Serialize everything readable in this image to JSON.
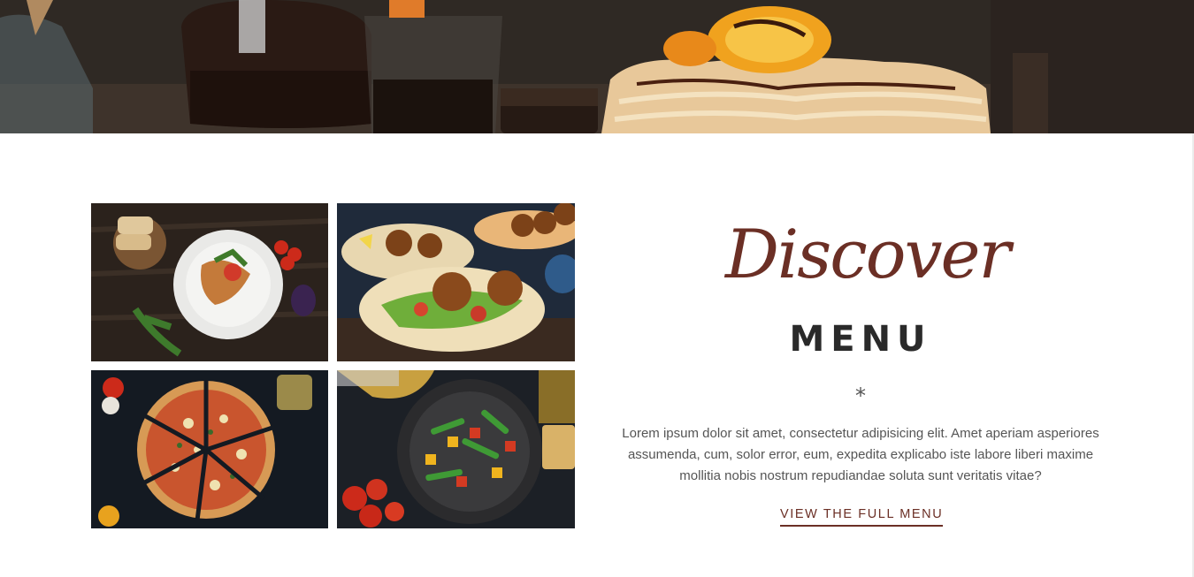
{
  "hero": {
    "image": "breakfast-table-pancakes-photo"
  },
  "gallery": {
    "images": [
      {
        "name": "grilled-chicken-plate-photo"
      },
      {
        "name": "falafel-wraps-photo"
      },
      {
        "name": "sliced-pizza-photo"
      },
      {
        "name": "vegetable-stir-fry-pan-photo"
      }
    ]
  },
  "intro": {
    "script_title": "Discover",
    "title": "MENU",
    "divider": "*",
    "body": "Lorem ipsum dolor sit amet, consectetur adipisicing elit. Amet aperiam asperiores assumenda, cum, solor error, eum, expedita explicabo iste labore liberi maxime mollitia nobis nostrum repudiandae soluta sunt veritatis vitae?",
    "cta_label": "VIEW THE FULL MENU"
  },
  "colors": {
    "accent": "#6b2f25",
    "heading": "#2a2a2a",
    "body_text": "#555555"
  }
}
